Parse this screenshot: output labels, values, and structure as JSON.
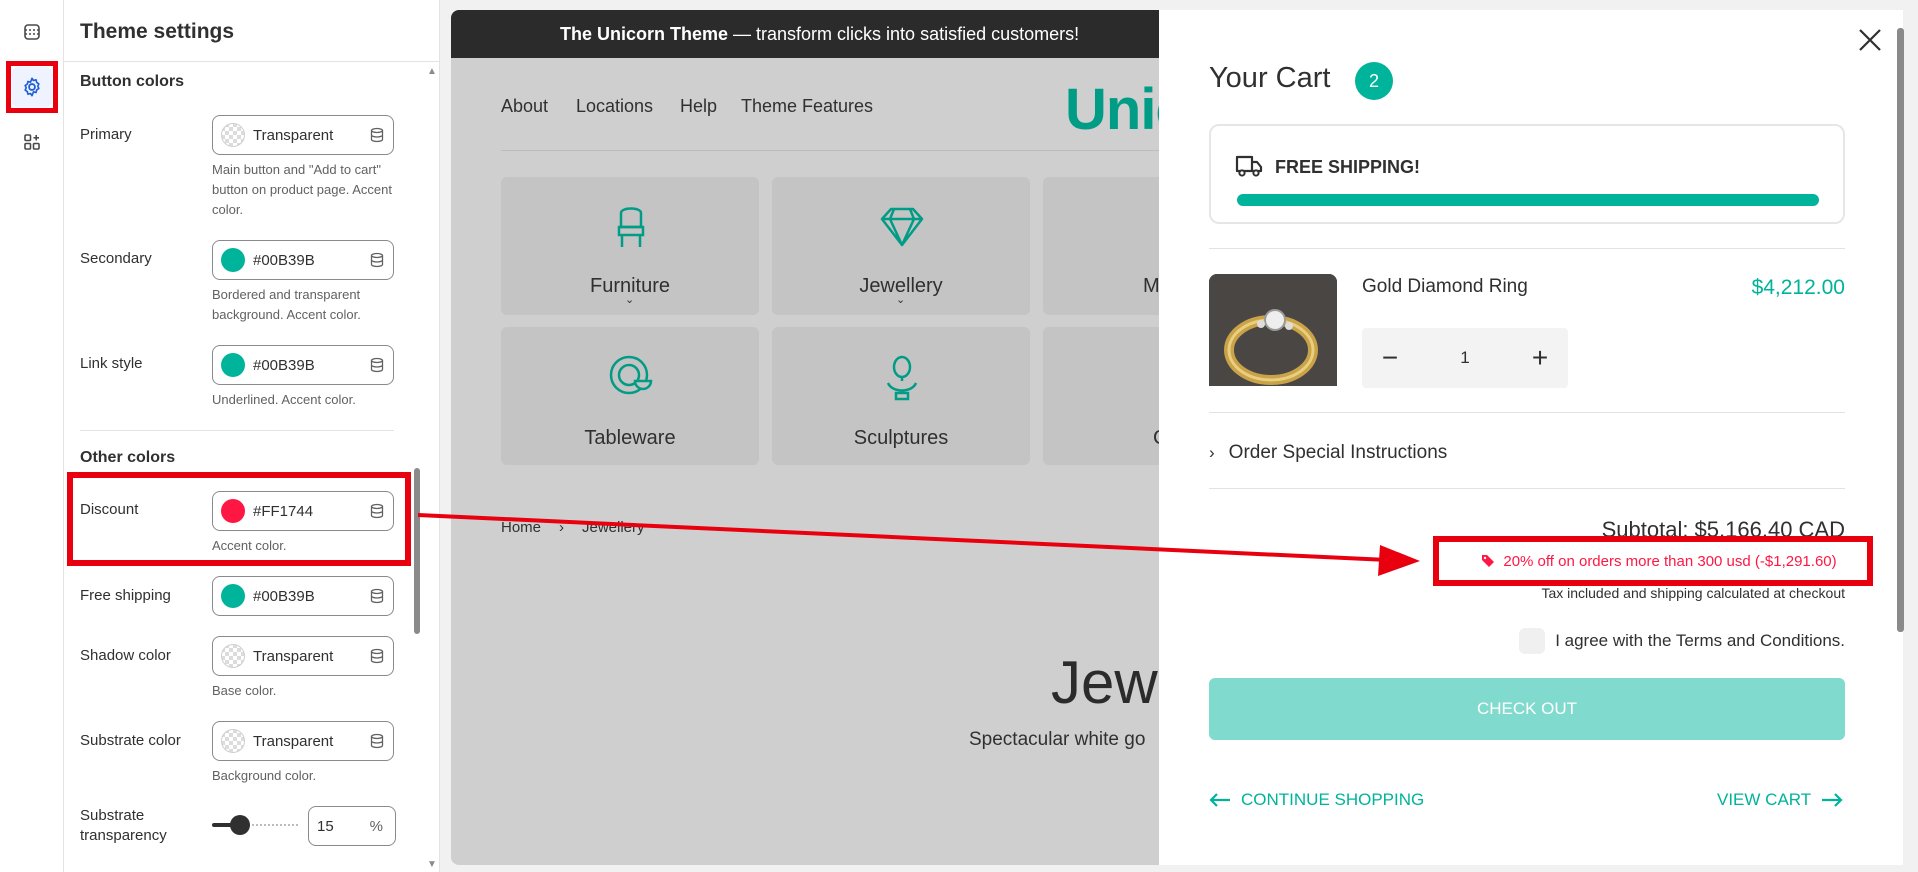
{
  "settings": {
    "title": "Theme settings",
    "button_colors": {
      "title": "Button colors",
      "primary": {
        "label": "Primary",
        "value": "Transparent",
        "help": "Main button and \"Add to cart\" button on product page. Accent color."
      },
      "secondary": {
        "label": "Secondary",
        "value": "#00B39B",
        "help": "Bordered and transparent background. Accent color."
      },
      "link_style": {
        "label": "Link style",
        "value": "#00B39B",
        "help": "Underlined. Accent color."
      }
    },
    "other_colors": {
      "title": "Other colors",
      "discount": {
        "label": "Discount",
        "value": "#FF1744",
        "help": "Accent color."
      },
      "free_shipping": {
        "label": "Free shipping",
        "value": "#00B39B"
      },
      "shadow": {
        "label": "Shadow color",
        "value": "Transparent",
        "help": "Base color."
      },
      "substrate": {
        "label": "Substrate color",
        "value": "Transparent",
        "help": "Background color."
      },
      "substrate_transparency": {
        "label_line1": "Substrate",
        "label_line2": "transparency",
        "value": "15",
        "unit": "%",
        "level_percent": 15
      }
    }
  },
  "colors": {
    "accent": "#00B39B",
    "discount": "#FF1744",
    "highlight": "#E8000F"
  },
  "preview": {
    "announcement_bold": "The Unicorn Theme",
    "announcement_rest": " — transform clicks into satisfied customers!",
    "nav": [
      "About",
      "Locations",
      "Help",
      "Theme Features"
    ],
    "logo": "Unic",
    "categories": [
      {
        "label": "Furniture",
        "icon": "chair-icon"
      },
      {
        "label": "Jewellery",
        "icon": "diamond-icon"
      },
      {
        "label": "Mi",
        "icon": "mirror-icon"
      },
      {
        "label": "Tableware",
        "icon": "plate-icon"
      },
      {
        "label": "Sculptures",
        "icon": "bust-icon"
      },
      {
        "label": "C",
        "icon": "candle-icon"
      }
    ],
    "breadcrumb": {
      "home": "Home",
      "separator": "›",
      "current": "Jewellery"
    },
    "heading": "Jewe",
    "subheading": "Spectacular white go"
  },
  "cart": {
    "title": "Your Cart",
    "count": "2",
    "shipping_label": "FREE SHIPPING!",
    "shipping_progress": 1.0,
    "item": {
      "name": "Gold Diamond Ring",
      "price": "$4,212.00",
      "quantity": "1",
      "minus": "−",
      "plus": "+"
    },
    "instructions": "Order Special Instructions",
    "subtotal": "Subtotal: $5,166.40 CAD",
    "discount": "20% off on orders more than 300 usd (-$1,291.60)",
    "tax": "Tax included and shipping calculated at checkout",
    "terms": "I agree with the Terms and Conditions.",
    "checkout": "CHECK OUT",
    "continue": "CONTINUE SHOPPING",
    "view_cart": "VIEW CART"
  }
}
